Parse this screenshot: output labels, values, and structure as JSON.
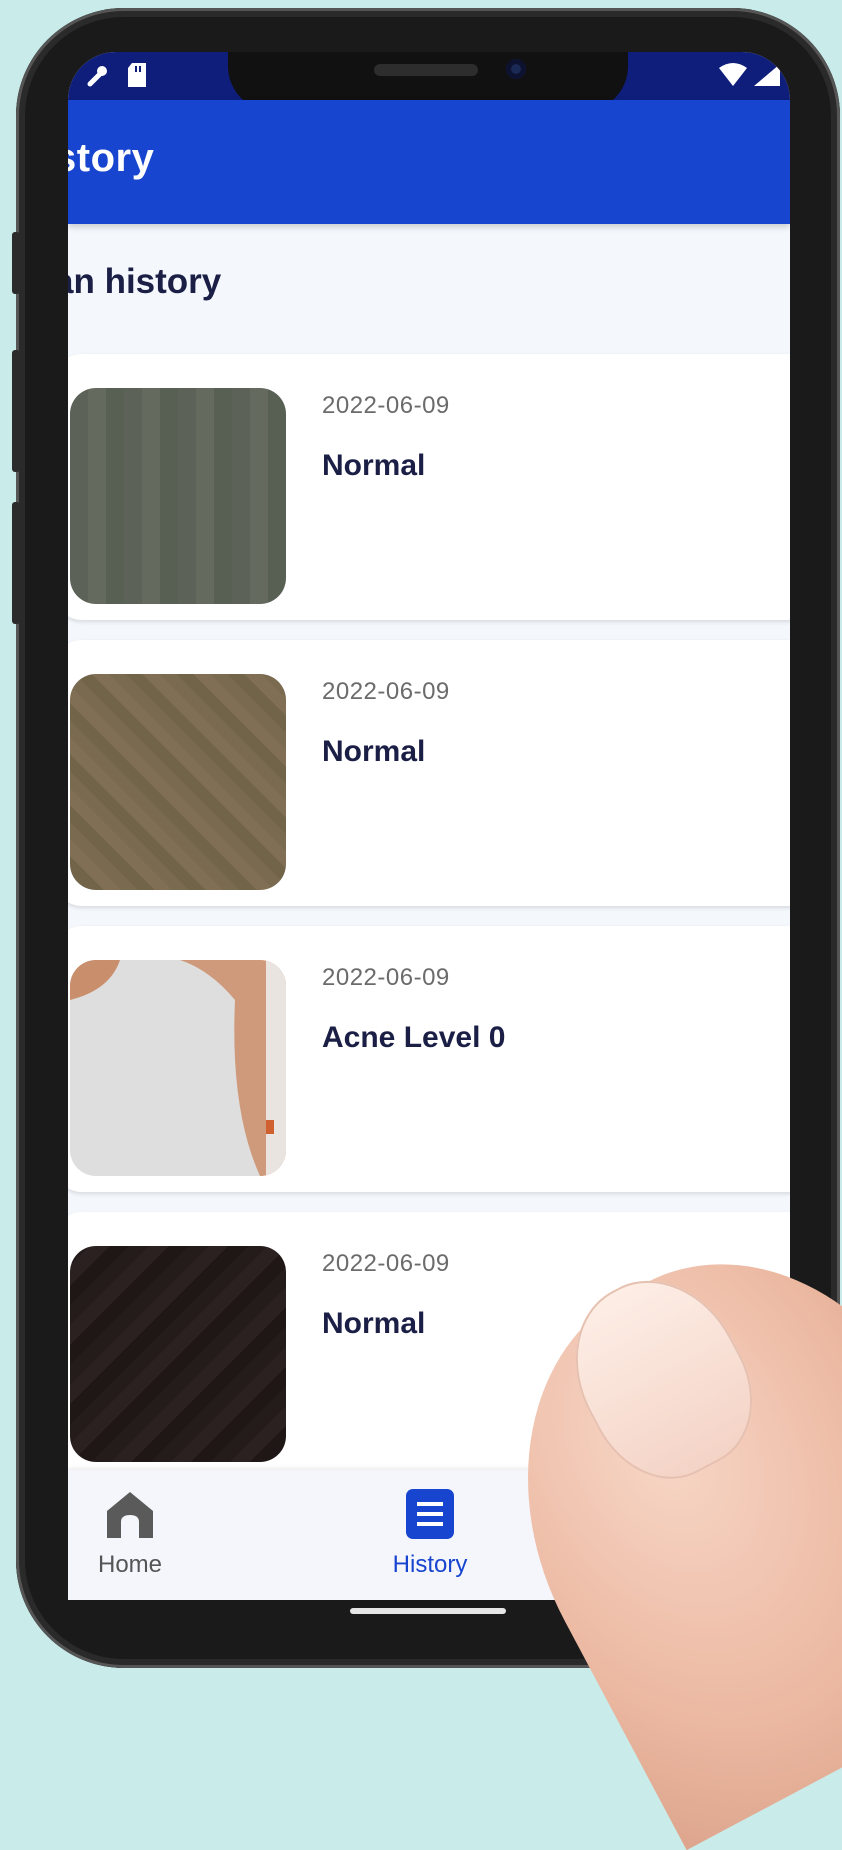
{
  "appbar": {
    "title": "story"
  },
  "section": {
    "title": "an history"
  },
  "history": [
    {
      "date": "2022-06-09",
      "result": "Normal",
      "thumb_color": "#5d6457"
    },
    {
      "date": "2022-06-09",
      "result": "Normal",
      "thumb_color": "#786a4f"
    },
    {
      "date": "2022-06-09",
      "result": "Acne Level 0",
      "thumb_color": "#dcdcdc"
    },
    {
      "date": "2022-06-09",
      "result": "Normal",
      "thumb_color": "#241c1b"
    }
  ],
  "nav": {
    "home_label": "Home",
    "history_label": "History",
    "active": "History",
    "active_color": "#1745cf",
    "inactive_color": "#555555"
  },
  "icons": {
    "status_left": [
      "tool-icon",
      "sd-card-icon"
    ],
    "status_right": [
      "wifi-icon",
      "signal-icon"
    ],
    "nav": [
      "home-icon",
      "list-icon"
    ]
  },
  "colors": {
    "appbar": "#1745cf",
    "statusbar": "#0f1e7a",
    "background": "#c9ebe9"
  }
}
